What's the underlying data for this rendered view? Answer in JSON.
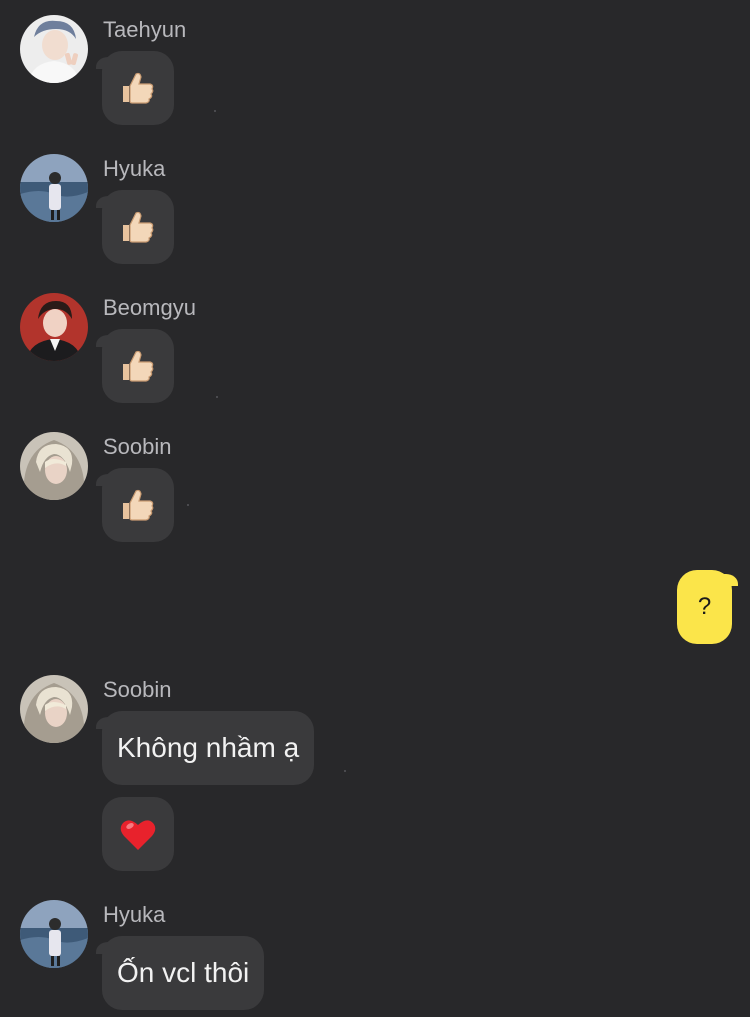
{
  "messages": [
    {
      "sender": "Taehyun",
      "content": "👍",
      "avatar_icon": "avatar-taehyun"
    },
    {
      "sender": "Hyuka",
      "content": "👍",
      "avatar_icon": "avatar-hyuka"
    },
    {
      "sender": "Beomgyu",
      "content": "👍",
      "avatar_icon": "avatar-beomgyu"
    },
    {
      "sender": "Soobin",
      "content": "👍",
      "avatar_icon": "avatar-soobin"
    },
    {
      "sender": "me",
      "text": "?"
    },
    {
      "sender": "Soobin",
      "text": "Không nhầm ạ",
      "avatar_icon": "avatar-soobin"
    },
    {
      "sender": "Soobin",
      "content": "❤️"
    },
    {
      "sender": "Hyuka",
      "text": "Ốn vcl thôi",
      "avatar_icon": "avatar-hyuka"
    }
  ],
  "colors": {
    "background": "#28282a",
    "incoming_bubble": "#3a3a3c",
    "outgoing_bubble": "#fbe54a",
    "name_text": "#b8b8bc"
  }
}
